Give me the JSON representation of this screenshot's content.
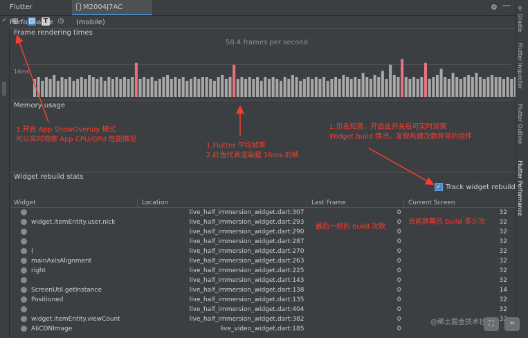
{
  "window": {
    "tabs": [
      {
        "label": "Flutter Performance"
      },
      {
        "label": "M2004J7AC (mobile)"
      }
    ]
  },
  "sidebar": {
    "items": [
      "Gradle",
      "Flutter Inspector",
      "Flutter Outline",
      "Flutter Performance"
    ]
  },
  "frame_panel": {
    "title": "Frame rendering times",
    "fps": "58.4 frames per second",
    "threshold_label": "16ms"
  },
  "memory_panel": {
    "title": "Memory usage"
  },
  "rebuild_panel": {
    "title": "Widget rebuild stats",
    "track_label": "Track widget rebuilds",
    "columns": [
      "Widget",
      "Location",
      "Last Frame",
      "Current Screen"
    ],
    "rows": [
      {
        "widget": "",
        "location": "live_half_immersion_widget.dart:307",
        "last": "0",
        "current": "32"
      },
      {
        "widget": "widget.itemEntity.user.nick",
        "location": "live_half_immersion_widget.dart:293",
        "last": "0",
        "current": "32"
      },
      {
        "widget": "",
        "location": "live_half_immersion_widget.dart:290",
        "last": "0",
        "current": "32"
      },
      {
        "widget": "",
        "location": "live_half_immersion_widget.dart:287",
        "last": "0",
        "current": "32"
      },
      {
        "widget": "(",
        "location": "live_half_immersion_widget.dart:270",
        "last": "0",
        "current": "32"
      },
      {
        "widget": "mainAxisAlignment",
        "location": "live_half_immersion_widget.dart:263",
        "last": "0",
        "current": "32"
      },
      {
        "widget": "right",
        "location": "live_half_immersion_widget.dart:225",
        "last": "0",
        "current": "32"
      },
      {
        "widget": "",
        "location": "live_half_immersion_widget.dart:143",
        "last": "0",
        "current": "32"
      },
      {
        "widget": "ScreenUtil.getInstance",
        "location": "live_half_immersion_widget.dart:138",
        "last": "0",
        "current": "14"
      },
      {
        "widget": "Positioned",
        "location": "live_half_immersion_widget.dart:135",
        "last": "0",
        "current": "32"
      },
      {
        "widget": "",
        "location": "live_half_immersion_widget.dart:404",
        "last": "0",
        "current": "32"
      },
      {
        "widget": "widget.itemEntity.viewCount",
        "location": "live_half_immersion_widget.dart:382",
        "last": "0",
        "current": "32"
      },
      {
        "widget": "AliCDNImage",
        "location": "live_video_widget.dart:185",
        "last": "0",
        "current": ""
      }
    ]
  },
  "annotations": {
    "a1_line1": "1.开启 App ShowOverlay 模式",
    "a1_line2": "可以实时观察 App CPU/GPU 性能情况",
    "a2_line1": "1.Flutter 平均帧率",
    "a2_line2": "2.红色代表渲染超 16ms 的帧",
    "a3_line1": "1.见名知意，开启此开关后可实时观察",
    "a3_line2": "Widget build 情况，发现构建次数异常的组件",
    "a4": "最后一帧的 build 次数",
    "a5": "当前屏幕已 build 多少次"
  },
  "watermark": "@稀土掘金技术社区",
  "chart_data": {
    "type": "bar",
    "title": "Frame rendering times",
    "threshold_label": "16ms",
    "highlight_color": "#e8727f",
    "normal_color": "#a8a8a8",
    "values": [
      9,
      10,
      8,
      10,
      9,
      11,
      8,
      10,
      9,
      10,
      8,
      9,
      10,
      9,
      11,
      10,
      9,
      10,
      8,
      10,
      9,
      10,
      9,
      10,
      9,
      10,
      17,
      9,
      10,
      9,
      10,
      8,
      9,
      10,
      11,
      9,
      10,
      9,
      10,
      8,
      9,
      10,
      9,
      10,
      10,
      9,
      8,
      10,
      11,
      9,
      10,
      16,
      9,
      10,
      9,
      10,
      9,
      10,
      8,
      10,
      9,
      10,
      9,
      8,
      10,
      9,
      11,
      10,
      8,
      9,
      10,
      9,
      10,
      9,
      10,
      8,
      9,
      10,
      9,
      11,
      10,
      9,
      10,
      9,
      12,
      10,
      9,
      11,
      10,
      13,
      9,
      16,
      11,
      10,
      19,
      10,
      9,
      10,
      9,
      10,
      17,
      9,
      10,
      11,
      14,
      10,
      9,
      12,
      10,
      9,
      10,
      11,
      10,
      12,
      10,
      9,
      10,
      11,
      10,
      10,
      9,
      10,
      9,
      10,
      11
    ],
    "highlight_indices": [
      26,
      51,
      94,
      100
    ]
  }
}
